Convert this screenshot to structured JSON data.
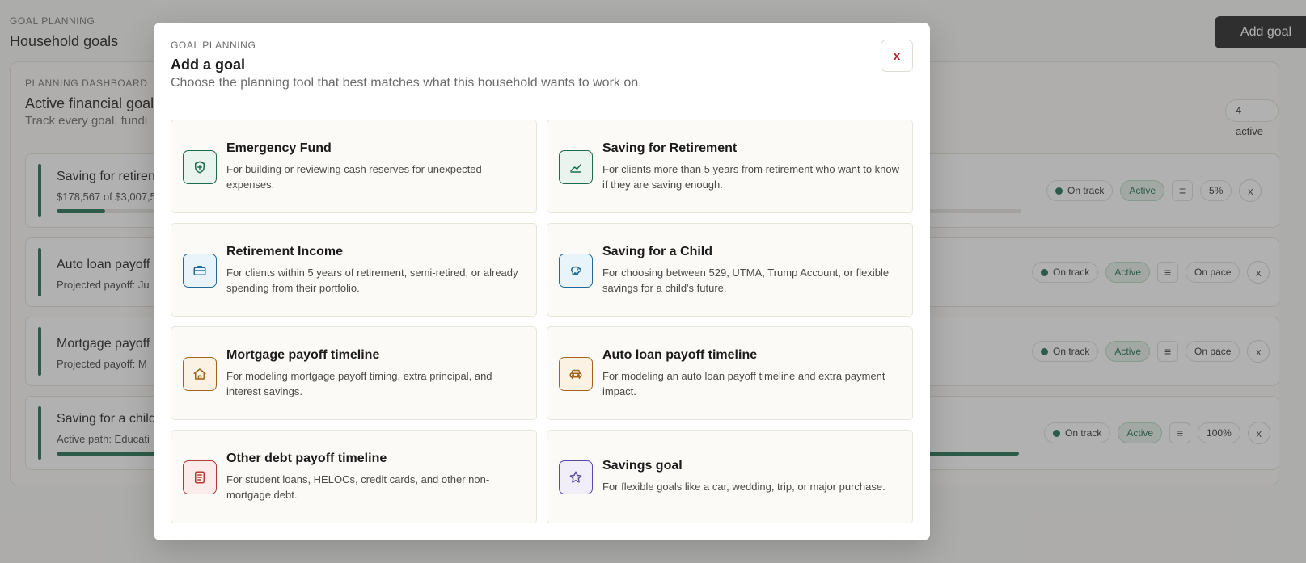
{
  "page": {
    "eyebrow": "GOAL PLANNING",
    "title": "Household goals",
    "add_goal_label": "Add goal"
  },
  "dashboard": {
    "eyebrow": "PLANNING DASHBOARD",
    "title": "Active financial goals",
    "subtitle": "Track every goal, fundi",
    "active_count": "4 active",
    "rows": [
      {
        "title": "Saving for retiren",
        "subtitle": "$178,567 of $3,007,5",
        "status": "On track",
        "state": "Active",
        "metric": "5%",
        "progress": 0.05
      },
      {
        "title": "Auto loan payoff",
        "subtitle": "Projected payoff: Ju",
        "status": "On track",
        "state": "Active",
        "metric": "On pace"
      },
      {
        "title": "Mortgage payoff",
        "subtitle": "Projected payoff: M",
        "status": "On track",
        "state": "Active",
        "metric": "On pace"
      },
      {
        "title": "Saving for a child",
        "subtitle": "Active path: Educati",
        "status": "On track",
        "state": "Active",
        "metric": "100%",
        "progress": 1.0
      }
    ],
    "row_close_label": "x"
  },
  "modal": {
    "eyebrow": "GOAL PLANNING",
    "title": "Add a goal",
    "description": "Choose the planning tool that best matches what this household wants to work on.",
    "close_label": "x",
    "options": [
      {
        "title": "Emergency Fund",
        "description": "For building or reviewing cash reserves for unexpected expenses.",
        "icon": "shield-plus-icon",
        "color": "#1d6b4d"
      },
      {
        "title": "Saving for Retirement",
        "description": "For clients more than 5 years from retirement who want to know if they are saving enough.",
        "icon": "trending-up-icon",
        "color": "#1d6b4d"
      },
      {
        "title": "Retirement Income",
        "description": "For clients within 5 years of retirement, semi-retired, or already spending from their portfolio.",
        "icon": "briefcase-icon",
        "color": "#1f6a99"
      },
      {
        "title": "Saving for a Child",
        "description": "For choosing between 529, UTMA, Trump Account, or flexible savings for a child's future.",
        "icon": "piggy-bank-icon",
        "color": "#1f6a99"
      },
      {
        "title": "Mortgage payoff timeline",
        "description": "For modeling mortgage payoff timing, extra principal, and interest savings.",
        "icon": "house-icon",
        "color": "#a0651b"
      },
      {
        "title": "Auto loan payoff timeline",
        "description": "For modeling an auto loan payoff timeline and extra payment impact.",
        "icon": "car-icon",
        "color": "#a0651b"
      },
      {
        "title": "Other debt payoff timeline",
        "description": "For student loans, HELOCs, credit cards, and other non-mortgage debt.",
        "icon": "document-icon",
        "color": "#b33a33"
      },
      {
        "title": "Savings goal",
        "description": "For flexible goals like a car, wedding, trip, or major purchase.",
        "icon": "star-icon",
        "color": "#5b48a8"
      }
    ]
  }
}
